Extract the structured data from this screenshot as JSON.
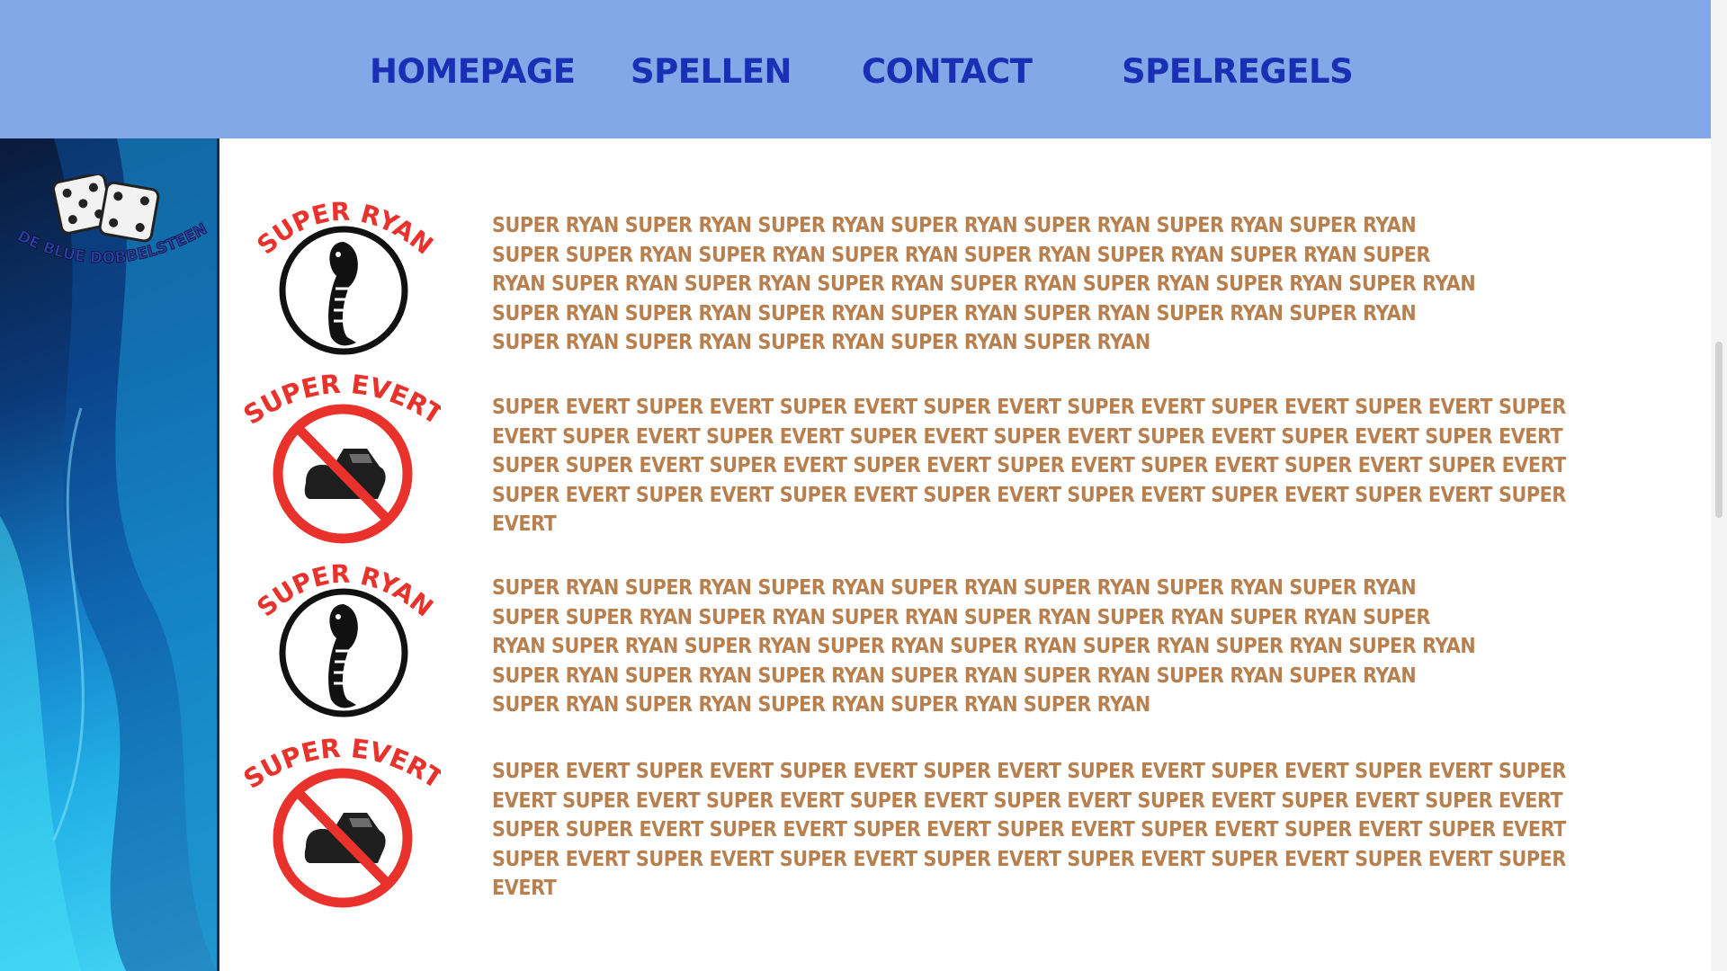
{
  "nav": {
    "items": [
      {
        "label": "HOMEPAGE"
      },
      {
        "label": "SPELLEN"
      },
      {
        "label": "CONTACT"
      },
      {
        "label": "SPELREGELS"
      }
    ]
  },
  "sidebar": {
    "logo_text": "DE BLUE DOBBELSTEEN"
  },
  "rows": [
    {
      "badge_title": "SUPER RYAN",
      "badge_icon": "cobra-icon",
      "text": "SUPER RYAN SUPER RYAN SUPER RYAN SUPER RYAN SUPER RYAN SUPER RYAN SUPER RYAN SUPER SUPER RYAN SUPER RYAN SUPER RYAN SUPER RYAN SUPER RYAN SUPER RYAN SUPER RYAN SUPER RYAN SUPER RYAN SUPER RYAN SUPER RYAN SUPER RYAN SUPER RYAN SUPER RYAN SUPER RYAN SUPER RYAN SUPER RYAN SUPER RYAN SUPER RYAN SUPER RYAN SUPER RYAN SUPER RYAN SUPER RYAN SUPER RYAN SUPER RYAN SUPER RYAN"
    },
    {
      "badge_title": "SUPER EVERT",
      "badge_icon": "no-boot-icon",
      "text": "SUPER EVERT SUPER EVERT SUPER EVERT SUPER EVERT SUPER EVERT SUPER EVERT SUPER EVERT SUPER EVERT SUPER EVERT SUPER EVERT SUPER EVERT SUPER EVERT SUPER EVERT SUPER EVERT SUPER EVERT SUPER SUPER EVERT SUPER EVERT SUPER EVERT SUPER EVERT SUPER EVERT SUPER EVERT SUPER EVERT SUPER EVERT SUPER EVERT SUPER EVERT SUPER EVERT SUPER EVERT SUPER EVERT SUPER EVERT SUPER EVERT"
    },
    {
      "badge_title": "SUPER RYAN",
      "badge_icon": "cobra-icon",
      "text": "SUPER RYAN SUPER RYAN SUPER RYAN SUPER RYAN SUPER RYAN SUPER RYAN SUPER RYAN SUPER SUPER RYAN SUPER RYAN SUPER RYAN SUPER RYAN SUPER RYAN SUPER RYAN SUPER RYAN SUPER RYAN SUPER RYAN SUPER RYAN SUPER RYAN SUPER RYAN SUPER RYAN SUPER RYAN SUPER RYAN SUPER RYAN SUPER RYAN SUPER RYAN SUPER RYAN SUPER RYAN SUPER RYAN SUPER RYAN SUPER RYAN SUPER RYAN SUPER RYAN SUPER RYAN"
    },
    {
      "badge_title": "SUPER EVERT",
      "badge_icon": "no-boot-icon",
      "text": "SUPER EVERT SUPER EVERT SUPER EVERT SUPER EVERT SUPER EVERT SUPER EVERT SUPER EVERT SUPER EVERT SUPER EVERT SUPER EVERT SUPER EVERT SUPER EVERT SUPER EVERT SUPER EVERT SUPER EVERT SUPER SUPER EVERT SUPER EVERT SUPER EVERT SUPER EVERT SUPER EVERT SUPER EVERT SUPER EVERT SUPER EVERT SUPER EVERT SUPER EVERT SUPER EVERT SUPER EVERT SUPER EVERT SUPER EVERT SUPER EVERT"
    }
  ],
  "colors": {
    "nav_bg": "#82a8e8",
    "nav_text": "#1b2fb4",
    "body_text": "#b9804f",
    "badge_red": "#e8322b"
  }
}
